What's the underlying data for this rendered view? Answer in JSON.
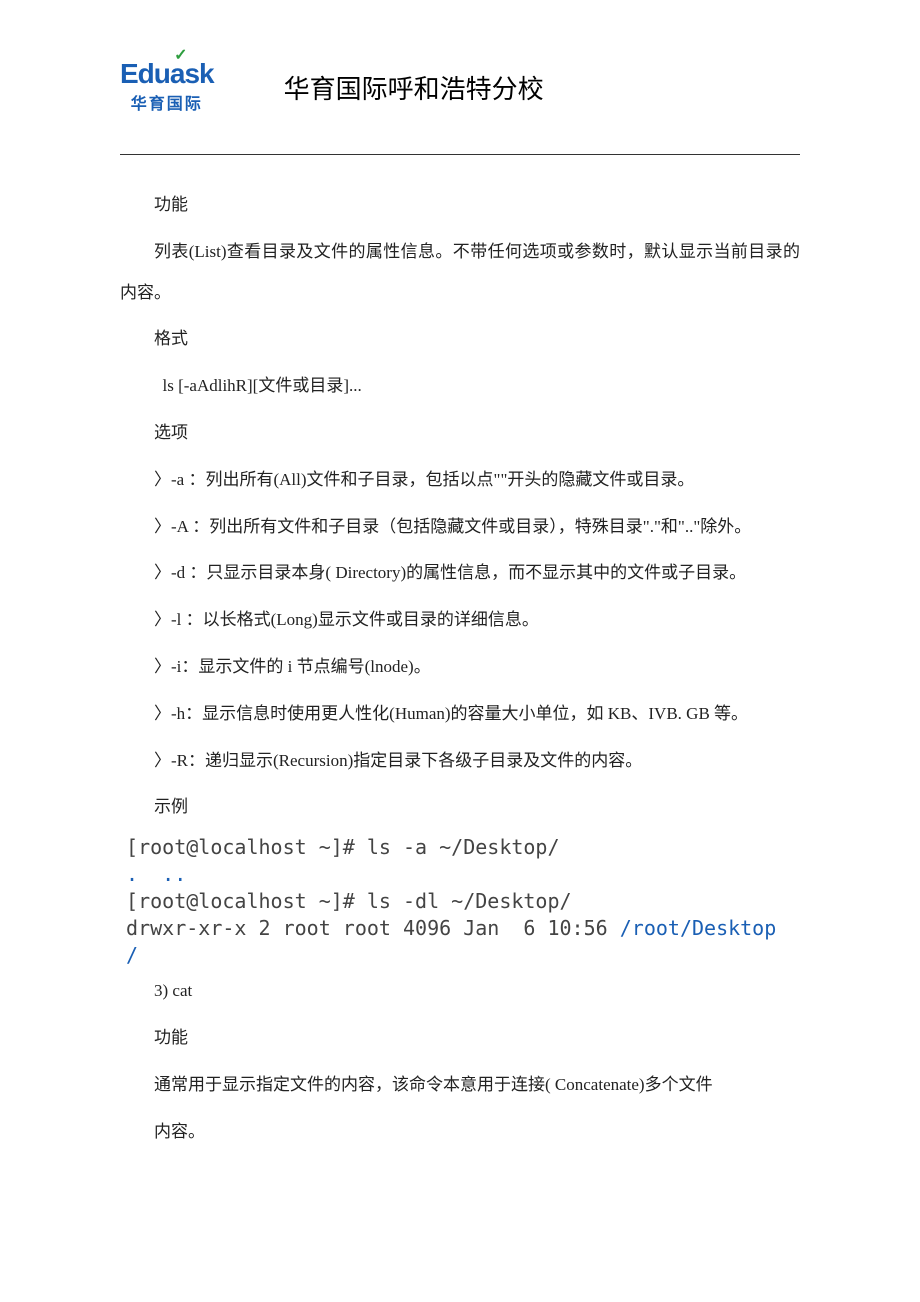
{
  "logo": {
    "top_prefix": "Edu",
    "top_accent_a": "a",
    "top_suffix": "sk",
    "check": "✓",
    "bottom": "华育国际"
  },
  "title": "华育国际呼和浩特分校",
  "body": {
    "p1": "功能",
    "p2": "列表(List)查看目录及文件的属性信息。不带任何选项或参数时，默认显示当前目录的内容。",
    "p3": "格式",
    "p4": "ls [-aAdlihR][文件或目录]...",
    "p5": "选项",
    "p6": "〉-a ：列出所有(All)文件和子目录，包括以点\"\"开头的隐藏文件或目录。",
    "p7": "〉-A ：列出所有文件和子目录（包括隐藏文件或目录），特殊目录\".\"和\"..\"除外。",
    "p8": "〉-d ：只显示目录本身( Directory)的属性信息，而不显示其中的文件或子目录。",
    "p9": "〉-l ：以长格式(Long)显示文件或目录的详细信息。",
    "p10": "〉-i：显示文件的 i 节点编号(lnode)。",
    "p11": "〉-h：显示信息时使用更人性化(Human)的容量大小单位，如 KB、IVB. GB 等。",
    "p12": "〉-R：递归显示(Recursion)指定目录下各级子目录及文件的内容。",
    "p13": "示例",
    "term_l1": " [root@localhost ~]# ls -a ~/Desktop/",
    "term_l2a": " ",
    "term_l2b": ".  ..",
    "term_l3": " [root@localhost ~]# ls -dl ~/Desktop/",
    "term_l4a": " drwxr-xr-x 2 root root 4096 Jan  6 10:56 ",
    "term_l4b": "/root/Desktop",
    "term_l5": " /",
    "p14": "3) cat",
    "p15": "功能",
    "p16": "通常用于显示指定文件的内容，该命令本意用于连接( Concatenate)多个文件",
    "p17": "内容。"
  }
}
